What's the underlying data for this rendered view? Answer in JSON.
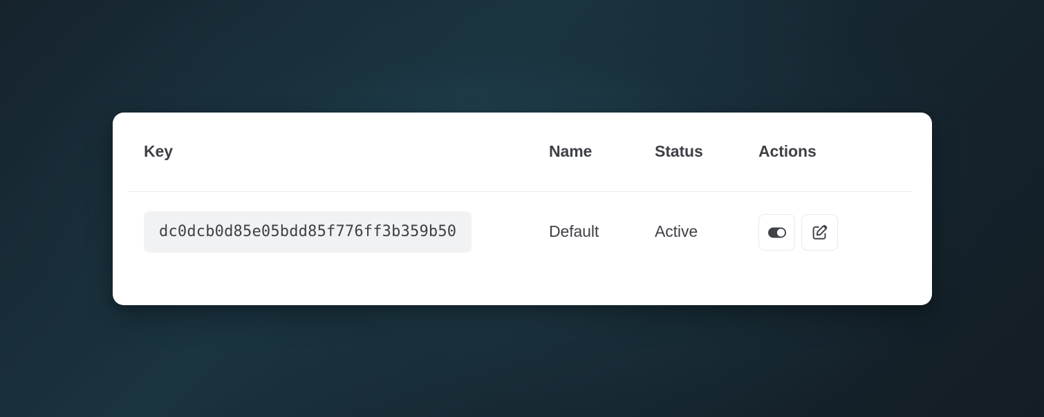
{
  "table": {
    "columns": [
      {
        "id": "key",
        "label": "Key"
      },
      {
        "id": "name",
        "label": "Name"
      },
      {
        "id": "status",
        "label": "Status"
      },
      {
        "id": "actions",
        "label": "Actions"
      }
    ],
    "rows": [
      {
        "key": "dc0dcb0d85e05bdd85f776ff3b359b50",
        "name": "Default",
        "status": "Active",
        "actions": [
          {
            "icon": "toggle-switch-on-icon",
            "state": "on"
          },
          {
            "icon": "edit-square-pencil-icon",
            "state": "default"
          }
        ]
      }
    ]
  },
  "theme": {
    "card_background": "#ffffff",
    "page_background_dark": "#16242e",
    "page_background_teal": "#1a3440",
    "key_pill_background": "#f1f2f3",
    "text_primary": "#3f3f46",
    "divider": "#e9eaec",
    "icon_color": "#3f4248",
    "button_border": "#e8e9eb"
  }
}
